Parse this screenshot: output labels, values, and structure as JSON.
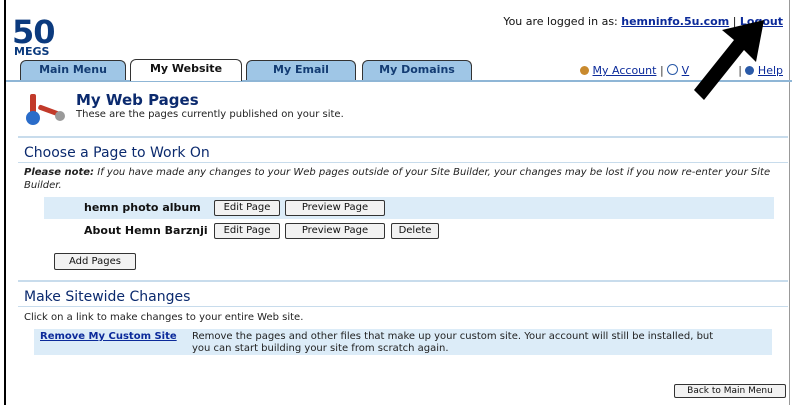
{
  "logo": {
    "number": "50",
    "word": "MEGS"
  },
  "header": {
    "logged_in_prefix": "You are logged in as:",
    "username": "hemninfo.5u.com",
    "separator": "|",
    "logout_label": "Logout"
  },
  "tabs": [
    {
      "label": "Main Menu"
    },
    {
      "label": "My Website"
    },
    {
      "label": "My Email"
    },
    {
      "label": "My Domains"
    }
  ],
  "top_links": {
    "my_account": "My Account",
    "mid": "V",
    "help": "Help",
    "sep": "|"
  },
  "page": {
    "title": "My Web Pages",
    "subtitle": "These are the pages currently published on your site."
  },
  "choose_section": {
    "heading": "Choose a Page to Work On",
    "note_bold": "Please note:",
    "note_text": "If you have made any changes to your Web pages outside of your Site Builder, your changes may be lost if you now re-enter your Site Builder.",
    "pages": [
      {
        "name": "hemn photo album",
        "edit": "Edit Page",
        "preview": "Preview Page"
      },
      {
        "name": "About Hemn Barznji",
        "edit": "Edit Page",
        "preview": "Preview Page",
        "delete": "Delete"
      }
    ],
    "add_pages": "Add Pages"
  },
  "sitewide": {
    "heading": "Make Sitewide Changes",
    "intro": "Click on a link to make changes to your entire Web site.",
    "link_label": "Remove My Custom Site",
    "link_desc_1": "Remove the pages and other files that make up your custom site. Your account will still be installed, but",
    "link_desc_2": "you can start building your site from scratch again."
  },
  "back_button": "Back to Main Menu",
  "colors": {
    "brand": "#0b3a7e",
    "tab": "#9fc6e6",
    "row": "#dcecf8",
    "link": "#0b2a9a"
  }
}
